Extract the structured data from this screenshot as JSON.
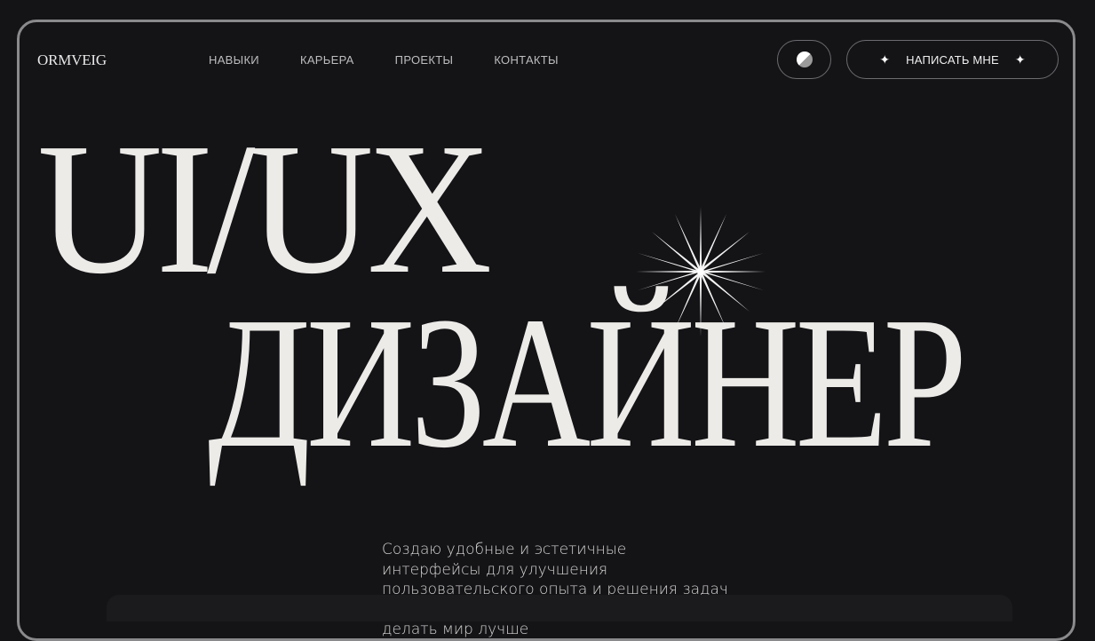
{
  "header": {
    "logo": "ORMVEIG",
    "nav": [
      {
        "label": "НАВЫКИ"
      },
      {
        "label": "КАРЬЕРА"
      },
      {
        "label": "ПРОЕКТЫ"
      },
      {
        "label": "КОНТАКТЫ"
      }
    ],
    "theme_toggle_icon": "half-moon-icon",
    "cta_label": "НАПИСАТЬ МНЕ",
    "cta_icons": [
      "sparkle-icon",
      "sparkle-icon"
    ]
  },
  "hero": {
    "line1": "UI/UX",
    "line2": "ДИЗАЙНЕР",
    "decoration_icon": "starburst-icon",
    "description": "Создаю удобные и эстетичные интерфейсы для улучшения пользовательского опыта и решения задач бизнеса. Своей работой я стремлюсь делать мир лучше"
  },
  "colors": {
    "background": "#141316",
    "frame_border": "#8a8a8d",
    "text_primary": "#ecebe8",
    "text_nav": "#bdbdbf"
  }
}
